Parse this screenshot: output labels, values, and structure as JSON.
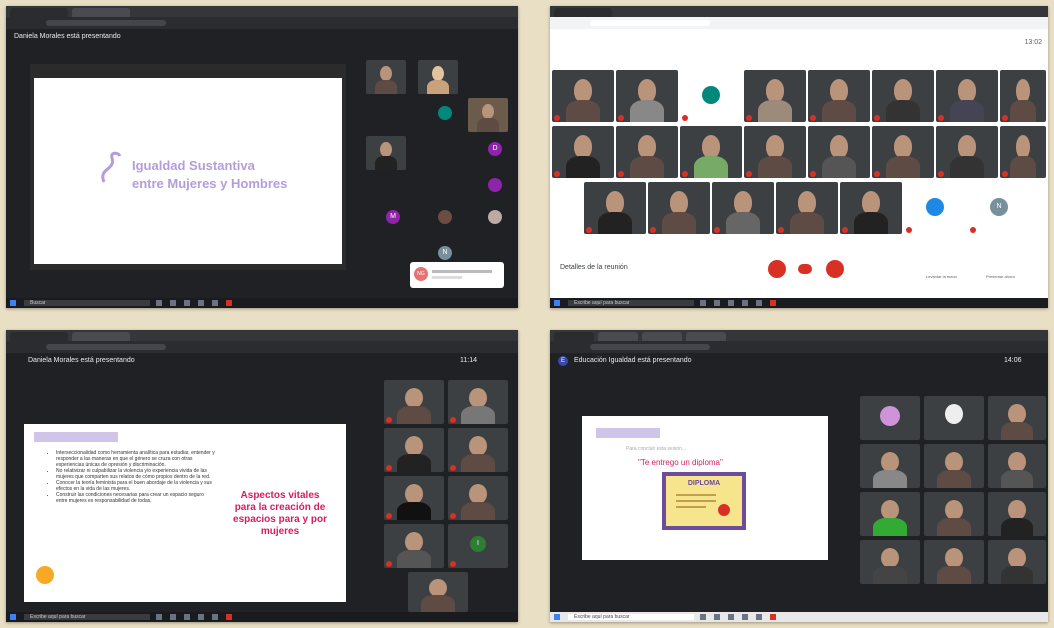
{
  "q1": {
    "presenter": "Daniela Morales está presentando",
    "slide_title_line1": "Igualdad Sustantiva",
    "slide_title_line2": "entre Mujeres y Hombres",
    "taskbar_search": "Buscar",
    "avatar_letters": [
      "D",
      "M",
      "N"
    ],
    "notification_avatar": "NG"
  },
  "q2": {
    "time": "13:02",
    "meeting_details": "Detalles de la reunión",
    "taskbar_search": "Escribe aquí para buscar",
    "side_actions": [
      "Levantar la mano",
      "Presentar ahora"
    ],
    "avatar_letters": [
      "N"
    ]
  },
  "q3": {
    "presenter": "Daniela Morales está presentando",
    "time": "11:14",
    "slide_heading_line1": "Aspectos vitales",
    "slide_heading_line2": "para la creación de",
    "slide_heading_line3": "espacios para y por",
    "slide_heading_line4": "mujeres",
    "bullets": [
      "Interseccionalidad como herramienta analítica para estudiar, entender y responder a las maneras en que el género se cruza con otras experiencias únicas de opresión y discriminación.",
      "No relativizar ni culpabilizar la violencia y/o experiencia vivida de las mujeres que comparten sus relatos de cómo propios dentro de la red.",
      "Conocer la teoría feminista para el buen abordaje de la violencia y sus efectos en la vida de las mujeres.",
      "Construir las condiciones necesarias para crear un espacio seguro entre mujeres es responsabilidad de todas."
    ],
    "taskbar_search": "Escribe aquí para buscar",
    "avatar_letters": [
      "I"
    ]
  },
  "q4": {
    "presenter": "Educación Igualdad está presentando",
    "time": "14:06",
    "slide_intro": "Para concluir esta sesión...",
    "slide_quote": "\"Te entrego un diploma\"",
    "diploma_label": "DIPLOMA",
    "taskbar_search": "Escribe aquí para buscar",
    "avatar_letters": [
      "E"
    ]
  },
  "colors": {
    "accent_purple": "#b39ddb",
    "heading_red": "#d81b60",
    "meet_red": "#d93025",
    "page_bg": "#e9dfc4"
  }
}
